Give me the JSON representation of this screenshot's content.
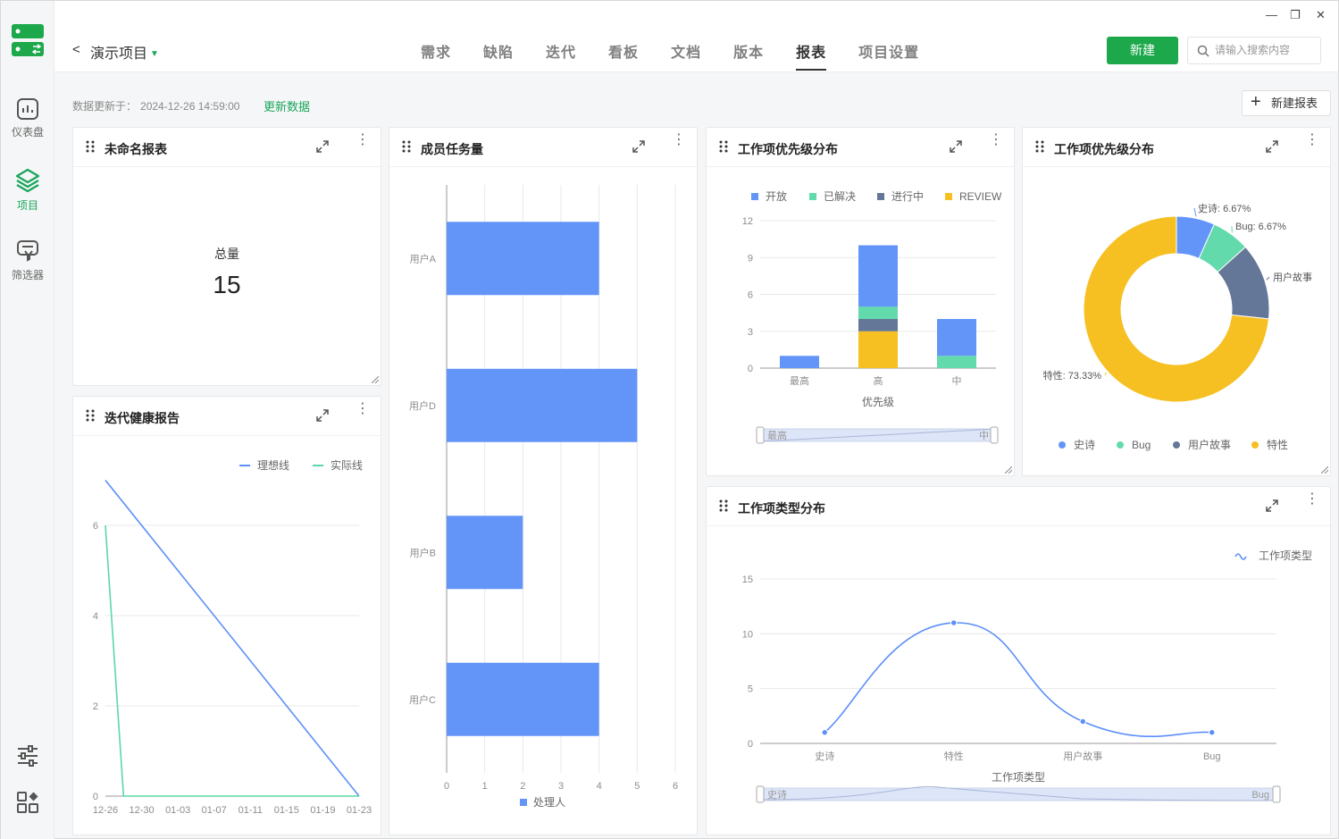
{
  "nav": {
    "back": "<",
    "project": "演示项目",
    "tabs": [
      "需求",
      "缺陷",
      "迭代",
      "看板",
      "文档",
      "版本",
      "报表",
      "项目设置"
    ],
    "active_tab": "报表",
    "new_button": "新建",
    "search_placeholder": "请输入搜索内容"
  },
  "window": {
    "minimize": "—",
    "restore": "❐",
    "close": "✕"
  },
  "sidebar": {
    "items": [
      {
        "label": "仪表盘",
        "icon": "dashboard-icon"
      },
      {
        "label": "项目",
        "icon": "layers-icon"
      },
      {
        "label": "筛选器",
        "icon": "filter-icon"
      }
    ],
    "bottom": [
      {
        "icon": "sliders-icon"
      },
      {
        "icon": "apps-icon"
      }
    ]
  },
  "header": {
    "updated_label": "数据更新于：",
    "updated_time": "2024-12-26 14:59:00",
    "refresh_link": "更新数据",
    "new_report_button": "新建报表"
  },
  "cards": {
    "total": {
      "title": "未命名报表",
      "label": "总量",
      "value": "15"
    },
    "burndown": {
      "title": "迭代健康报告"
    },
    "members": {
      "title": "成员任务量"
    },
    "priority_bar": {
      "title": "工作项优先级分布"
    },
    "priority_pie": {
      "title": "工作项优先级分布"
    },
    "type_line": {
      "title": "工作项类型分布"
    }
  },
  "chart_data": [
    {
      "id": "burndown",
      "type": "line",
      "x": [
        "12-26",
        "12-30",
        "01-03",
        "01-07",
        "01-11",
        "01-15",
        "01-19",
        "01-23"
      ],
      "ylim": [
        0,
        7
      ],
      "yticks": [
        0,
        2,
        4,
        6
      ],
      "series": [
        {
          "name": "理想线",
          "color": "#5b8ff9",
          "points": [
            [
              "12-26",
              7
            ],
            [
              "01-23",
              0
            ]
          ]
        },
        {
          "name": "实际线",
          "color": "#5ad8a6",
          "points": [
            [
              "12-26",
              6
            ],
            [
              "12-28",
              0
            ],
            [
              "01-23",
              0
            ]
          ]
        }
      ]
    },
    {
      "id": "members",
      "type": "bar",
      "orientation": "horizontal",
      "categories": [
        "用户A",
        "用户D",
        "用户B",
        "用户C"
      ],
      "values": [
        4,
        5,
        2,
        4
      ],
      "xlim": [
        0,
        6
      ],
      "xticks": [
        0,
        1,
        2,
        3,
        4,
        5,
        6
      ],
      "legend": "处理人",
      "color": "#6395f9"
    },
    {
      "id": "priority_bar",
      "type": "bar",
      "stacked": true,
      "categories": [
        "最高",
        "高",
        "中"
      ],
      "xlabel": "优先级",
      "ylim": [
        0,
        12
      ],
      "yticks": [
        0,
        3,
        6,
        9,
        12
      ],
      "series": [
        {
          "name": "开放",
          "color": "#6395f9",
          "values": [
            1,
            5,
            3
          ]
        },
        {
          "name": "已解决",
          "color": "#62daab",
          "values": [
            0,
            1,
            1
          ]
        },
        {
          "name": "进行中",
          "color": "#657798",
          "values": [
            0,
            1,
            0
          ]
        },
        {
          "name": "REVIEW",
          "color": "#f6c022",
          "values": [
            0,
            3,
            0
          ]
        }
      ],
      "slider": {
        "start": "最高",
        "end": "中"
      }
    },
    {
      "id": "priority_pie",
      "type": "pie",
      "donut": true,
      "slices": [
        {
          "name": "史诗",
          "value": 6.67,
          "label": "史诗: 6.67%",
          "color": "#6395f9"
        },
        {
          "name": "Bug",
          "value": 6.67,
          "label": "Bug: 6.67%",
          "color": "#62daab"
        },
        {
          "name": "用户故事",
          "value": 13.33,
          "label": "用户故事",
          "color": "#657798"
        },
        {
          "name": "特性",
          "value": 73.33,
          "label": "特性: 73.33%",
          "color": "#f6c022"
        }
      ],
      "legend": [
        "史诗",
        "Bug",
        "用户故事",
        "特性"
      ]
    },
    {
      "id": "type_line",
      "type": "line",
      "smooth": true,
      "categories": [
        "史诗",
        "特性",
        "用户故事",
        "Bug"
      ],
      "values": [
        1,
        11,
        2,
        1
      ],
      "xlabel": "工作项类型",
      "ylim": [
        0,
        15
      ],
      "yticks": [
        0,
        5,
        10,
        15
      ],
      "legend": "工作项类型",
      "color": "#5b8ff9",
      "slider": {
        "start": "史诗",
        "end": "Bug"
      }
    }
  ]
}
